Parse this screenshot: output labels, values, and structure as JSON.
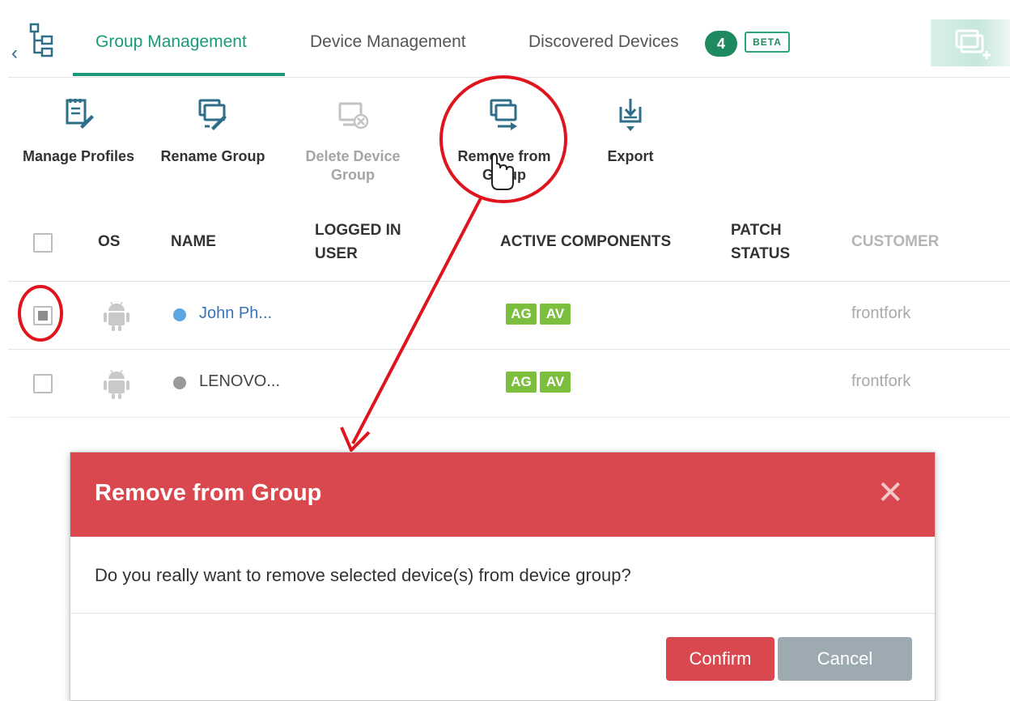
{
  "tabs": {
    "group_management": "Group Management",
    "device_management": "Device Management",
    "discovered_devices": "Discovered Devices",
    "discovered_count": "4",
    "beta": "BETA"
  },
  "toolbar": {
    "manage_profiles": "Manage Profiles",
    "rename_group": "Rename Group",
    "delete_line1": "Delete Device",
    "delete_line2": "Group",
    "remove_line1": "Remove from",
    "remove_line2": "Group",
    "export": "Export"
  },
  "table": {
    "headers": {
      "os": "OS",
      "name": "NAME",
      "logged_line1": "LOGGED IN",
      "logged_line2": "USER",
      "active_components": "ACTIVE COMPONENTS",
      "patch_line1": "PATCH",
      "patch_line2": "STATUS",
      "customer": "CUSTOMER"
    },
    "rows": [
      {
        "name": "John Ph...",
        "name_color": "#3a72b9",
        "dot_color": "#5ea6e0",
        "components": [
          "AG",
          "AV"
        ],
        "customer": "frontfork",
        "checked": true
      },
      {
        "name": "LENOVO...",
        "name_color": "#444444",
        "dot_color": "#9a9a9a",
        "components": [
          "AG",
          "AV"
        ],
        "customer": "frontfork",
        "checked": false
      }
    ]
  },
  "dialog": {
    "title": "Remove from Group",
    "message": "Do you really want to remove selected device(s) from device group?",
    "confirm": "Confirm",
    "cancel": "Cancel"
  },
  "colors": {
    "accent": "#1a9a7a",
    "danger": "#d9484f",
    "component_badge": "#7cbf3f",
    "annotation": "#e0141e"
  }
}
